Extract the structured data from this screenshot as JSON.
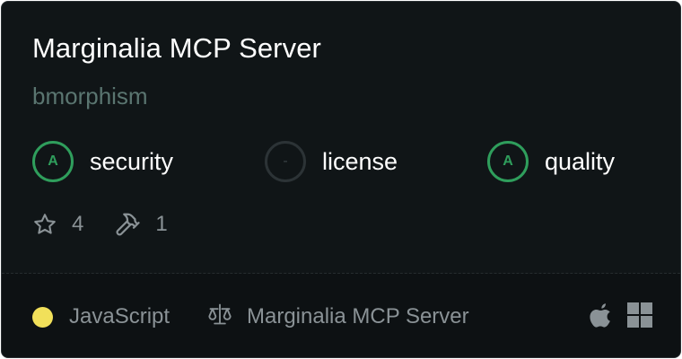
{
  "server": {
    "title": "Marginalia MCP Server",
    "author": "bmorphism"
  },
  "scores": [
    {
      "grade": "A",
      "label": "security",
      "status": "pass"
    },
    {
      "grade": "-",
      "label": "license",
      "status": "none"
    },
    {
      "grade": "A",
      "label": "quality",
      "status": "pass"
    }
  ],
  "stats": {
    "stars": "4",
    "tools": "1"
  },
  "footer": {
    "language": "JavaScript",
    "language_color": "#f1e05a",
    "license": "Marginalia MCP Server",
    "platforms": [
      "apple-icon",
      "windows-icon"
    ]
  },
  "colors": {
    "card_bg": "#101517",
    "grade_pass": "#2f9e5c",
    "muted_text": "#8a9296"
  }
}
